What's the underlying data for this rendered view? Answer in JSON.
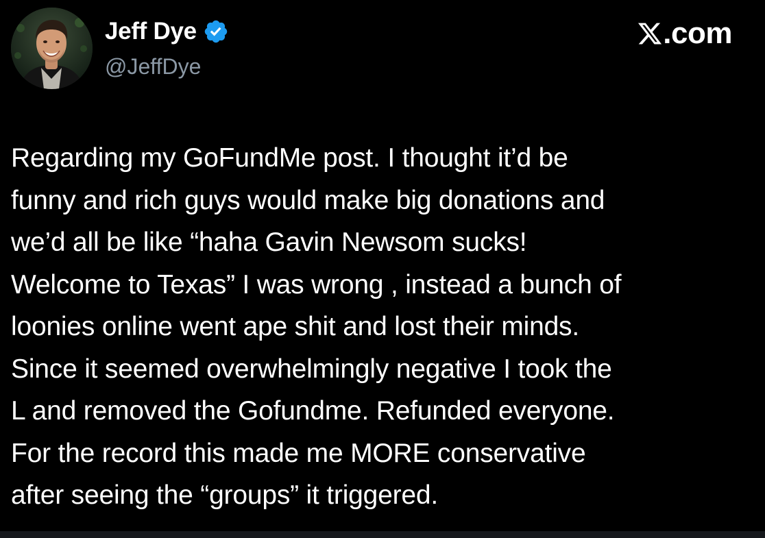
{
  "author": {
    "display_name": "Jeff Dye",
    "handle": "@JeffDye",
    "verified": true,
    "verified_color": "#1d9bf0"
  },
  "brand": {
    "suffix": ".com",
    "logo_icon": "x-logo-icon"
  },
  "tweet": {
    "lines": [
      "Regarding my GoFundMe post.  I thought it’d be",
      "funny and rich guys would make big donations and",
      "we’d all be like “haha Gavin Newsom sucks!",
      "Welcome to Texas” I was wrong , instead a bunch of",
      "loonies online went ape shit and lost their minds.",
      "Since it seemed overwhelmingly negative I took the",
      "L and removed the Gofundme. Refunded everyone.",
      "For the record this made me MORE conservative",
      "after seeing the “groups” it triggered."
    ]
  },
  "colors": {
    "background": "#000000",
    "text": "#ffffff",
    "secondary_text": "#8b98a5"
  }
}
